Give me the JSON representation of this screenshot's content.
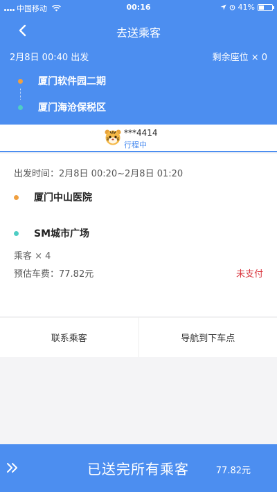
{
  "status": {
    "carrier": "中国移动",
    "time": "00:16",
    "battery": "41%",
    "battery_level": 0.41
  },
  "nav": {
    "title": "去送乘客"
  },
  "trip": {
    "departure": "2月8日 00:40 出发",
    "seats": "剩余座位 × 0",
    "from": "厦门软件园二期",
    "to": "厦门海沧保税区"
  },
  "passenger": {
    "phone": "***4414",
    "status": "行程中",
    "depart_window": "出发时间：2月8日 00:20~2月8日 01:20",
    "pickup": "厦门中山医院",
    "dropoff": "SM城市广场",
    "count": "乘客 × 4",
    "fare": "预估车费：77.82元",
    "pay_status": "未支付"
  },
  "actions": {
    "contact": "联系乘客",
    "navigate": "导航到下车点"
  },
  "bottom": {
    "label": "已送完所有乘客",
    "price": "77.82元"
  },
  "colors": {
    "brand": "#4c8ef0",
    "pickup_dot": "#f0a040",
    "dropoff_dot": "#4ecdc4",
    "alert": "#d9363e"
  }
}
